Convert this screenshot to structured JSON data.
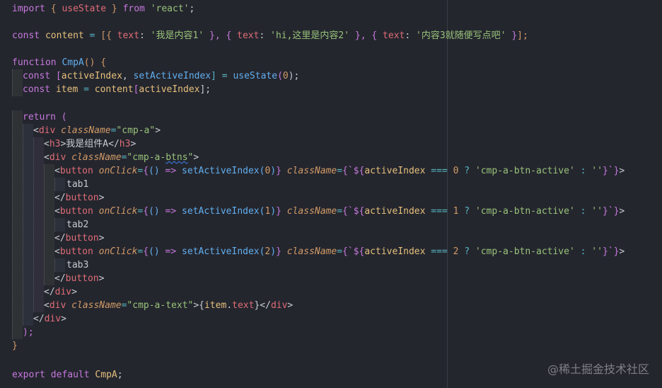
{
  "colors": {
    "background": "#24262e",
    "keyword": "#c678dd",
    "function": "#61afef",
    "string": "#98c379",
    "variable": "#e5c07b",
    "property": "#e06c75",
    "number": "#d19a66"
  },
  "code": {
    "l1": {
      "a": "import",
      "b": " { ",
      "c": "useState",
      "d": " } ",
      "e": "from",
      "f": " ",
      "g": "'react'",
      "h": ";"
    },
    "l3": {
      "a": "const",
      "b": " ",
      "c": "content",
      "d": " = ",
      "e": "[{",
      "f": " text",
      "g": ": ",
      "h": "'我是内容1'",
      "i": " }, ",
      "j": "{",
      "k": " text",
      "l": ": ",
      "m": "'hi,这里是内容2'",
      "n": " }, ",
      "o": "{",
      "p": " text",
      "q": ": ",
      "r": "'内容3就随便写点吧'",
      "s": " }",
      "t": "];"
    },
    "l5": {
      "a": "function",
      "b": " ",
      "c": "CmpA",
      "d": "()",
      "e": " {"
    },
    "l6": {
      "a": "const",
      "b": " [",
      "c": "activeIndex",
      "d": ", ",
      "e": "setActiveIndex",
      "f": "] = ",
      "g": "useState",
      "h": "(",
      "i": "0",
      "j": ");"
    },
    "l7": {
      "a": "const",
      "b": " ",
      "c": "item",
      "d": " = ",
      "e": "content",
      "f": "[",
      "g": "activeIndex",
      "h": "];"
    },
    "l9": {
      "a": "return",
      "b": " ("
    },
    "l10": {
      "a": "<",
      "b": "div",
      "c": " ",
      "d": "className",
      "e": "=",
      "f": "\"cmp-a\"",
      "g": ">"
    },
    "l11": {
      "a": "<",
      "b": "h3",
      "c": ">我是组件A</",
      "d": "h3",
      "e": ">"
    },
    "l12": {
      "a": "<",
      "b": "div",
      "c": " ",
      "d": "className",
      "e": "=",
      "f": "\"cmp-a-",
      "g": "btns",
      "h": "\"",
      "i": ">"
    },
    "btn0": {
      "a": "<",
      "b": "button",
      "c": " ",
      "d": "onClick",
      "e": "=",
      "f": "{",
      "g": "()",
      "h": " => ",
      "i": "setActiveIndex",
      "j": "(",
      "k": "0",
      "l": ")",
      "m": "}",
      "n": " ",
      "o": "className",
      "p": "=",
      "q": "{`",
      "r": "${",
      "s": "activeIndex",
      "t": " === ",
      "u": "0",
      "v": " ? ",
      "w": "'cmp-a-btn-active'",
      "x": " : ",
      "y": "''",
      "z": "}`}",
      "zz": ">"
    },
    "l14": "tab1",
    "l15": {
      "a": "</",
      "b": "button",
      "c": ">"
    },
    "btn1": {
      "a": "<",
      "b": "button",
      "c": " ",
      "d": "onClick",
      "e": "=",
      "f": "{",
      "g": "()",
      "h": " => ",
      "i": "setActiveIndex",
      "j": "(",
      "k": "1",
      "l": ")",
      "m": "}",
      "n": " ",
      "o": "className",
      "p": "=",
      "q": "{`",
      "r": "${",
      "s": "activeIndex",
      "t": " === ",
      "u": "1",
      "v": " ? ",
      "w": "'cmp-a-btn-active'",
      "x": " : ",
      "y": "''",
      "z": "}`}",
      "zz": ">"
    },
    "l17": "tab2",
    "l18": {
      "a": "</",
      "b": "button",
      "c": ">"
    },
    "btn2": {
      "a": "<",
      "b": "button",
      "c": " ",
      "d": "onClick",
      "e": "=",
      "f": "{",
      "g": "()",
      "h": " => ",
      "i": "setActiveIndex",
      "j": "(",
      "k": "2",
      "l": ")",
      "m": "}",
      "n": " ",
      "o": "className",
      "p": "=",
      "q": "{`",
      "r": "${",
      "s": "activeIndex",
      "t": " === ",
      "u": "2",
      "v": " ? ",
      "w": "'cmp-a-btn-active'",
      "x": " : ",
      "y": "''",
      "z": "}`}",
      "zz": ">"
    },
    "l20": "tab3",
    "l21": {
      "a": "</",
      "b": "button",
      "c": ">"
    },
    "l22": {
      "a": "</",
      "b": "div",
      "c": ">"
    },
    "l23": {
      "a": "<",
      "b": "div",
      "c": " ",
      "d": "className",
      "e": "=",
      "f": "\"cmp-a-text\"",
      "g": ">{",
      "h": "item",
      "i": ".",
      "j": "text",
      "k": "}</",
      "l": "div",
      "m": ">"
    },
    "l24": {
      "a": "</",
      "b": "div",
      "c": ">"
    },
    "l25": ");",
    "l26": "}",
    "l28": {
      "a": "export",
      "b": " ",
      "c": "default",
      "d": " ",
      "e": "CmpA",
      "f": ";"
    }
  },
  "watermark": "@稀土掘金技术社区"
}
